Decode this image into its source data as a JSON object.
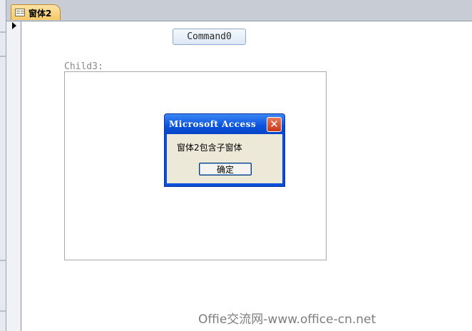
{
  "tab": {
    "title": "窗体2",
    "icon": "form-icon"
  },
  "form": {
    "command_button": "Command0",
    "subform_label": "Child3:"
  },
  "dialog": {
    "title": "Microsoft Access",
    "message": "窗体2包含子窗体",
    "ok_label": "确定",
    "close_glyph": "✕"
  },
  "watermark": "Offie交流网-www.office-cn.net",
  "colors": {
    "tab_active": "#f6c968",
    "dialog_titlebar": "#0a53dc",
    "dialog_body": "#ece9d8"
  }
}
